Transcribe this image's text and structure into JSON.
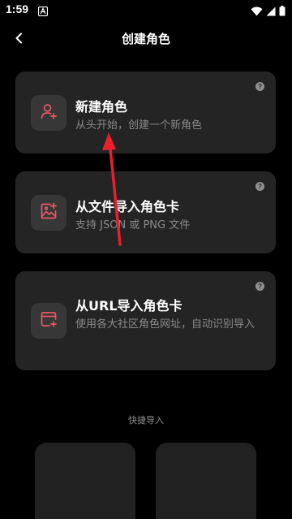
{
  "status_bar": {
    "time": "1:59",
    "notification_icon": "app-notification-icon",
    "icons": [
      "wifi-icon",
      "cell-signal-icon",
      "battery-icon"
    ]
  },
  "header": {
    "back_icon": "chevron-left-icon",
    "title": "创建角色"
  },
  "cards": [
    {
      "title": "新建角色",
      "subtitle": "从头开始，创建一个新角色",
      "icon": "person-add-icon",
      "help": "?"
    },
    {
      "title": "从文件导入角色卡",
      "subtitle": "支持 JSON 或 PNG 文件",
      "icon": "image-add-icon",
      "help": "?"
    },
    {
      "title": "从URL导入角色卡",
      "subtitle": "使用各大社区角色网址，自动识别导入",
      "icon": "browser-add-icon",
      "help": "?"
    }
  ],
  "quick_import": {
    "label": "快捷导入"
  },
  "colors": {
    "background": "#000000",
    "card": "#242424",
    "icon_tile": "#373737",
    "accent": "#e95866",
    "annotation_arrow": "#e8202c"
  }
}
